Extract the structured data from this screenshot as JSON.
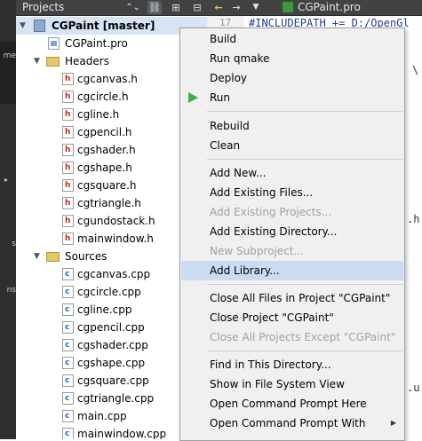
{
  "modebar": {
    "labels": [
      "me",
      "s",
      "ns"
    ],
    "arrow": "▸"
  },
  "toolbar": {
    "combo_label": "Projects",
    "combo_chevron": "⌃⌄",
    "link_icon": "⛓",
    "split_icon": "⊞",
    "close_icon": "⊟",
    "back_icon": "←",
    "fwd_icon": "→",
    "down_icon": "▼",
    "open_file": "CGPaint.pro"
  },
  "tree": {
    "project": "CGPaint [master]",
    "pro_file": "CGPaint.pro",
    "headers_label": "Headers",
    "headers": [
      "cgcanvas.h",
      "cgcircle.h",
      "cgline.h",
      "cgpencil.h",
      "cgshader.h",
      "cgshape.h",
      "cgsquare.h",
      "cgtriangle.h",
      "cgundostack.h",
      "mainwindow.h"
    ],
    "sources_label": "Sources",
    "sources": [
      "cgcanvas.cpp",
      "cgcircle.cpp",
      "cgline.cpp",
      "cgpencil.cpp",
      "cgshader.cpp",
      "cgshape.cpp",
      "cgsquare.cpp",
      "cgtriangle.cpp",
      "main.cpp",
      "mainwindow.cpp"
    ]
  },
  "editor": {
    "line_number": "17",
    "first_line": "#INCLUDEPATH += D:/OpenGl",
    "frag_backslash": "\\",
    "frag_h": ".h",
    "frag_ui": ".u"
  },
  "menu": {
    "items": [
      {
        "label": "Build",
        "disabled": false
      },
      {
        "label": "Run qmake",
        "disabled": false
      },
      {
        "label": "Deploy",
        "disabled": false
      },
      {
        "label": "Run",
        "disabled": false,
        "icon": "run-icon"
      },
      {
        "label": "Rebuild",
        "disabled": false
      },
      {
        "label": "Clean",
        "disabled": false
      },
      {
        "label": "Add New...",
        "disabled": false
      },
      {
        "label": "Add Existing Files...",
        "disabled": false
      },
      {
        "label": "Add Existing Projects...",
        "disabled": true
      },
      {
        "label": "Add Existing Directory...",
        "disabled": false
      },
      {
        "label": "New Subproject...",
        "disabled": true
      },
      {
        "label": "Add Library...",
        "disabled": false,
        "hover": true
      },
      {
        "label": "Close All Files in Project \"CGPaint\"",
        "disabled": false
      },
      {
        "label": "Close Project \"CGPaint\"",
        "disabled": false
      },
      {
        "label": "Close All Projects Except \"CGPaint\"",
        "disabled": true
      },
      {
        "label": "Find in This Directory...",
        "disabled": false
      },
      {
        "label": "Show in File System View",
        "disabled": false
      },
      {
        "label": "Open Command Prompt Here",
        "disabled": false
      },
      {
        "label": "Open Command Prompt With",
        "disabled": false,
        "submenu": true
      }
    ],
    "submenu_arrow": "▶"
  }
}
